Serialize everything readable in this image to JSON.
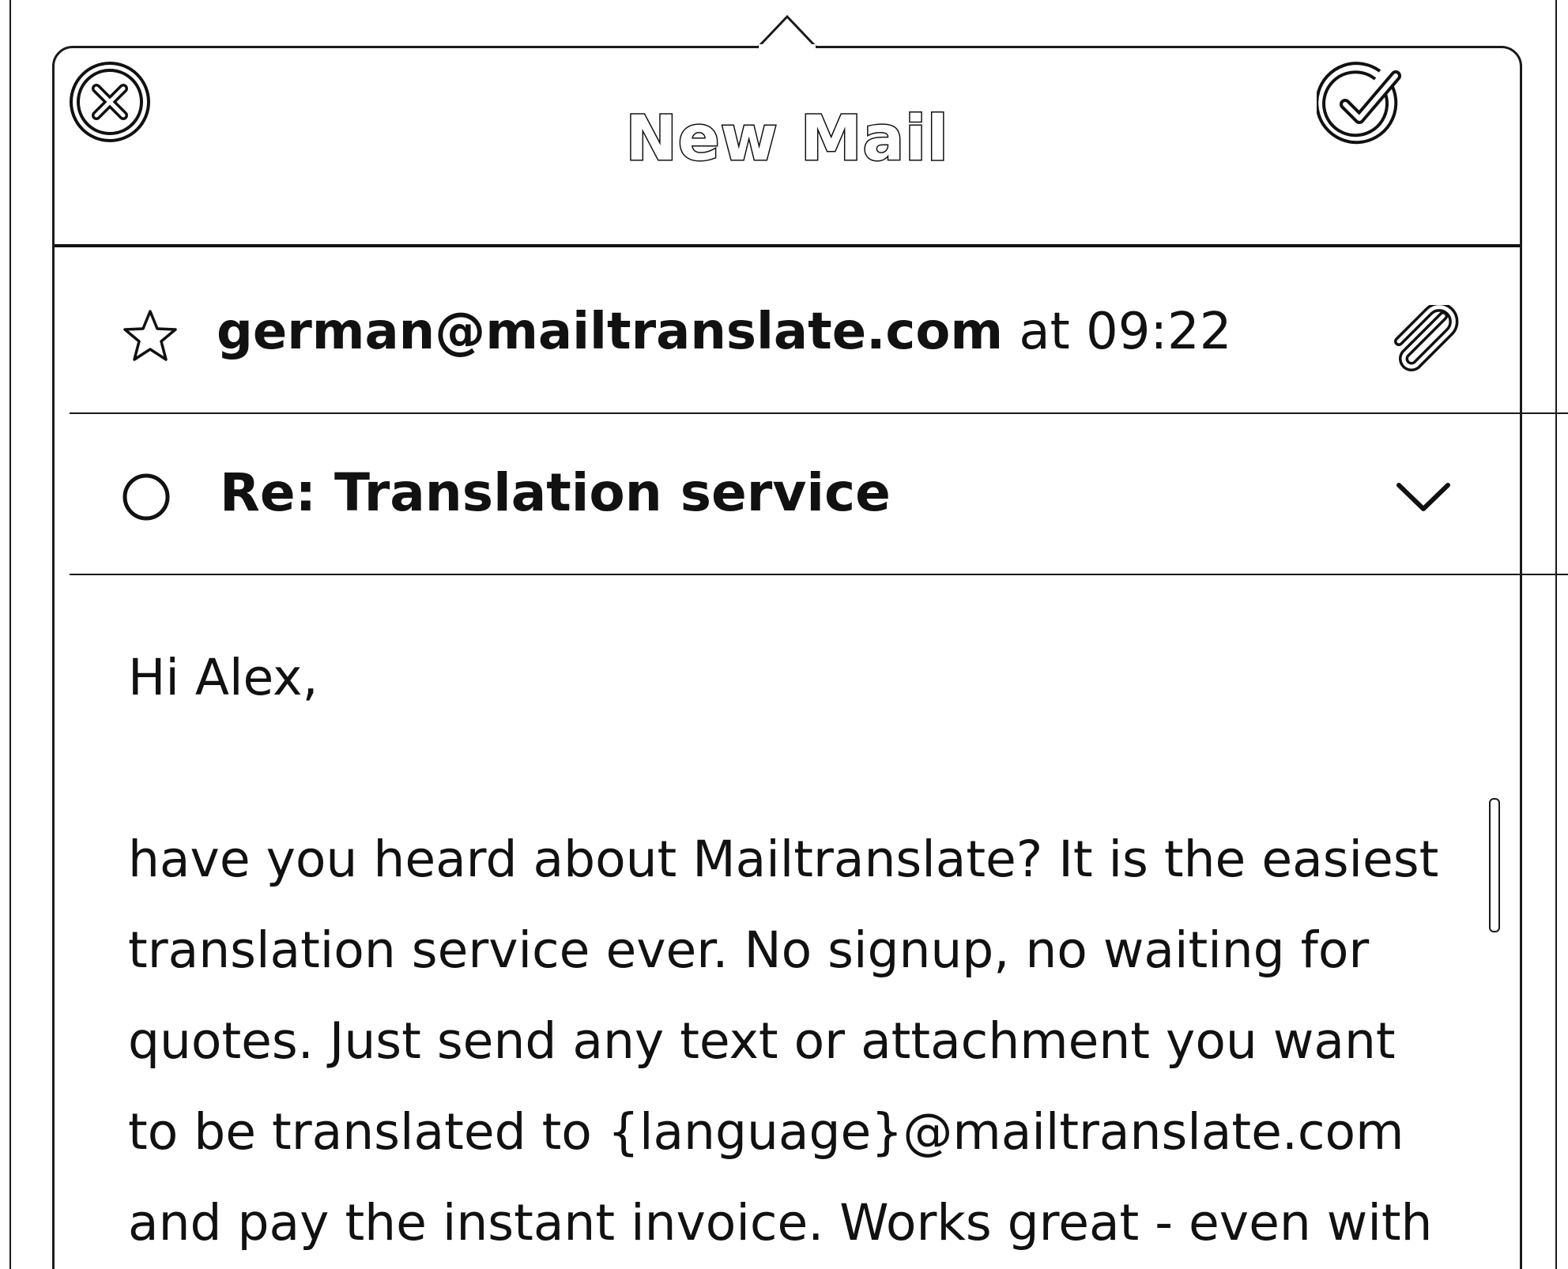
{
  "header": {
    "title": "New Mail"
  },
  "icons": {
    "cancel": "close-circle-icon",
    "confirm": "check-circle-icon",
    "favorite": "star-icon",
    "attachment": "paperclip-icon",
    "status": "circle-icon",
    "expand": "chevron-down-icon"
  },
  "message": {
    "from_address": "german@mailtranslate.com",
    "from_time": " at 09:22",
    "subject": "Re: Translation service",
    "greeting": "Hi Alex,",
    "body_lines": [
      "have you heard about Mailtranslate? It is the easiest",
      "translation service ever. No signup, no waiting for",
      "quotes. Just send any text or attachment you want",
      "to be translated to {language}@mailtranslate.com",
      "and pay the instant invoice.  Works great - even with"
    ]
  }
}
